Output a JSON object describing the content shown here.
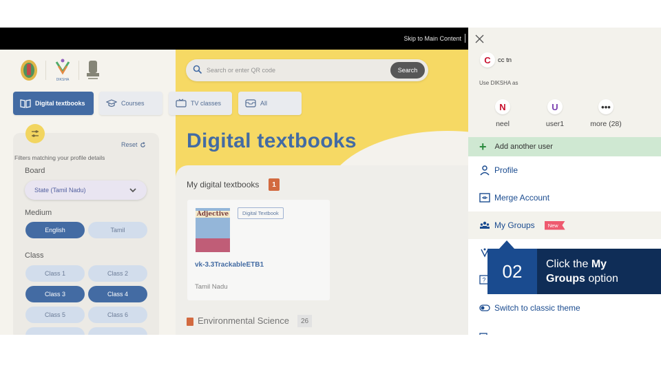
{
  "top_bar": {
    "skip_link": "Skip to Main Content"
  },
  "logos": [
    "tamil-nadu-emblem",
    "diksha-logo",
    "national-emblem"
  ],
  "diksha_caption": "DIKSHA",
  "search": {
    "placeholder": "Search or enter QR code",
    "button_label": "Search"
  },
  "tabs": [
    {
      "label": "Digital textbooks",
      "icon": "book-icon",
      "active": true
    },
    {
      "label": "Courses",
      "icon": "graduation-cap-icon",
      "active": false
    },
    {
      "label": "TV classes",
      "icon": "tv-icon",
      "active": false
    },
    {
      "label": "All",
      "icon": "inbox-icon",
      "active": false
    }
  ],
  "filters": {
    "reset_label": "Reset",
    "hint": "Filters matching your profile details",
    "board_label": "Board",
    "board_value": "State (Tamil Nadu)",
    "medium_label": "Medium",
    "medium_options": [
      {
        "label": "English",
        "active": true
      },
      {
        "label": "Tamil",
        "active": false
      }
    ],
    "class_label": "Class",
    "class_options": [
      {
        "label": "Class 1",
        "active": false
      },
      {
        "label": "Class 2",
        "active": false
      },
      {
        "label": "Class 3",
        "active": true
      },
      {
        "label": "Class 4",
        "active": true
      },
      {
        "label": "Class 5",
        "active": false
      },
      {
        "label": "Class 6",
        "active": false
      }
    ]
  },
  "main": {
    "heading": "Digital textbooks",
    "my_textbooks": {
      "title": "My digital textbooks",
      "count": "1"
    },
    "book": {
      "cover_title": "Adjective",
      "type_badge": "Digital Textbook",
      "name": "vk-3.3TrackableETB1",
      "board": "Tamil Nadu"
    },
    "section2": {
      "title": "Environmental Science",
      "count": "26"
    }
  },
  "drawer": {
    "current_user": {
      "initial": "C",
      "name": "cc tn",
      "color": "#c8102e"
    },
    "use_as_label": "Use DIKSHA as",
    "profiles": [
      {
        "initial": "N",
        "name": "neel",
        "color": "#c8102e"
      },
      {
        "initial": "U",
        "name": "user1",
        "color": "#7a3fb0"
      }
    ],
    "more_label": "more (28)",
    "add_user_label": "Add another user",
    "menu": [
      {
        "label": "Profile",
        "icon": "user-icon"
      },
      {
        "label": "Merge Account",
        "icon": "merge-icon"
      },
      {
        "label": "My Groups",
        "icon": "groups-icon",
        "badge": "New"
      },
      {
        "label": "Switch to classic theme",
        "icon": "toggle-icon"
      }
    ]
  },
  "callout": {
    "step": "02",
    "text_before": "Click the",
    "bold_1": "My",
    "bold_2": "Groups",
    "text_after": "option"
  }
}
